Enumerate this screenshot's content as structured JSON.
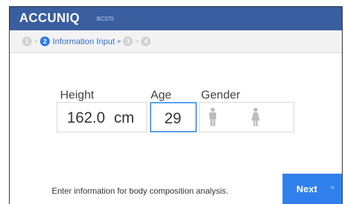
{
  "header": {
    "brand": "ACCUNIQ",
    "model": "BC370"
  },
  "steps": {
    "step1": "1",
    "step2": "2",
    "step2_label": "Information Input",
    "step3": "3",
    "step4": "4",
    "arrow": "»"
  },
  "form": {
    "height_label": "Height",
    "height_value": "162.0",
    "height_unit": "cm",
    "age_label": "Age",
    "age_value": "29",
    "gender_label": "Gender"
  },
  "footer": {
    "hint": "Enter information for body composition analysis.",
    "next_label": "Next",
    "next_arrow": "»"
  },
  "colors": {
    "header": "#3a5ea0",
    "accent": "#2f80ec",
    "focus_border": "#4f9df0",
    "icon_gray": "#bdbdbd"
  },
  "icons": {
    "male": "male-person-icon",
    "female": "female-person-icon"
  }
}
